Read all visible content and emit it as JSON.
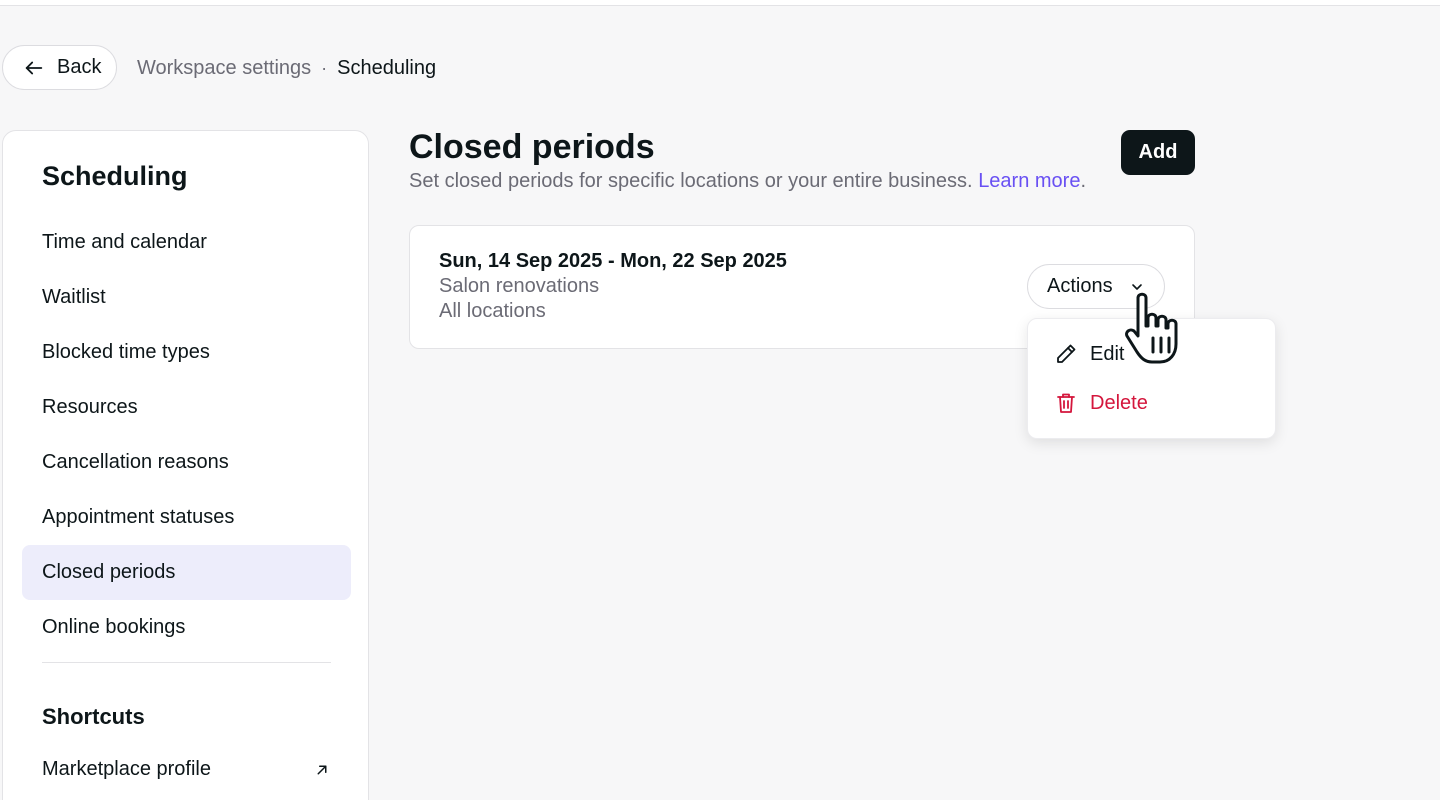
{
  "header": {
    "back_label": "Back",
    "breadcrumb": {
      "parent": "Workspace settings",
      "separator": "·",
      "current": "Scheduling"
    }
  },
  "sidebar": {
    "title": "Scheduling",
    "items": [
      {
        "label": "Time and calendar"
      },
      {
        "label": "Waitlist"
      },
      {
        "label": "Blocked time types"
      },
      {
        "label": "Resources"
      },
      {
        "label": "Cancellation reasons"
      },
      {
        "label": "Appointment statuses"
      },
      {
        "label": "Closed periods",
        "active": true
      },
      {
        "label": "Online bookings"
      }
    ],
    "shortcuts_title": "Shortcuts",
    "shortcuts": [
      {
        "label": "Marketplace profile",
        "icon": "external-link-icon"
      }
    ]
  },
  "main": {
    "title": "Closed periods",
    "subtitle": "Set closed periods for specific locations or your entire business.",
    "learn_more": "Learn more",
    "subtitle_end": ".",
    "add_label": "Add",
    "periods": [
      {
        "dates": "Sun, 14 Sep 2025 - Mon, 22 Sep 2025",
        "reason": "Salon renovations",
        "locations": "All locations",
        "actions_label": "Actions"
      }
    ],
    "actions_menu": [
      {
        "label": "Edit",
        "icon": "pencil-icon"
      },
      {
        "label": "Delete",
        "icon": "trash-icon"
      }
    ]
  },
  "colors": {
    "accent": "#6950f3",
    "primary_button": "#0d1619",
    "danger": "#d4163c",
    "active_nav_bg": "#ededfb",
    "page_bg": "#f7f7f8"
  }
}
